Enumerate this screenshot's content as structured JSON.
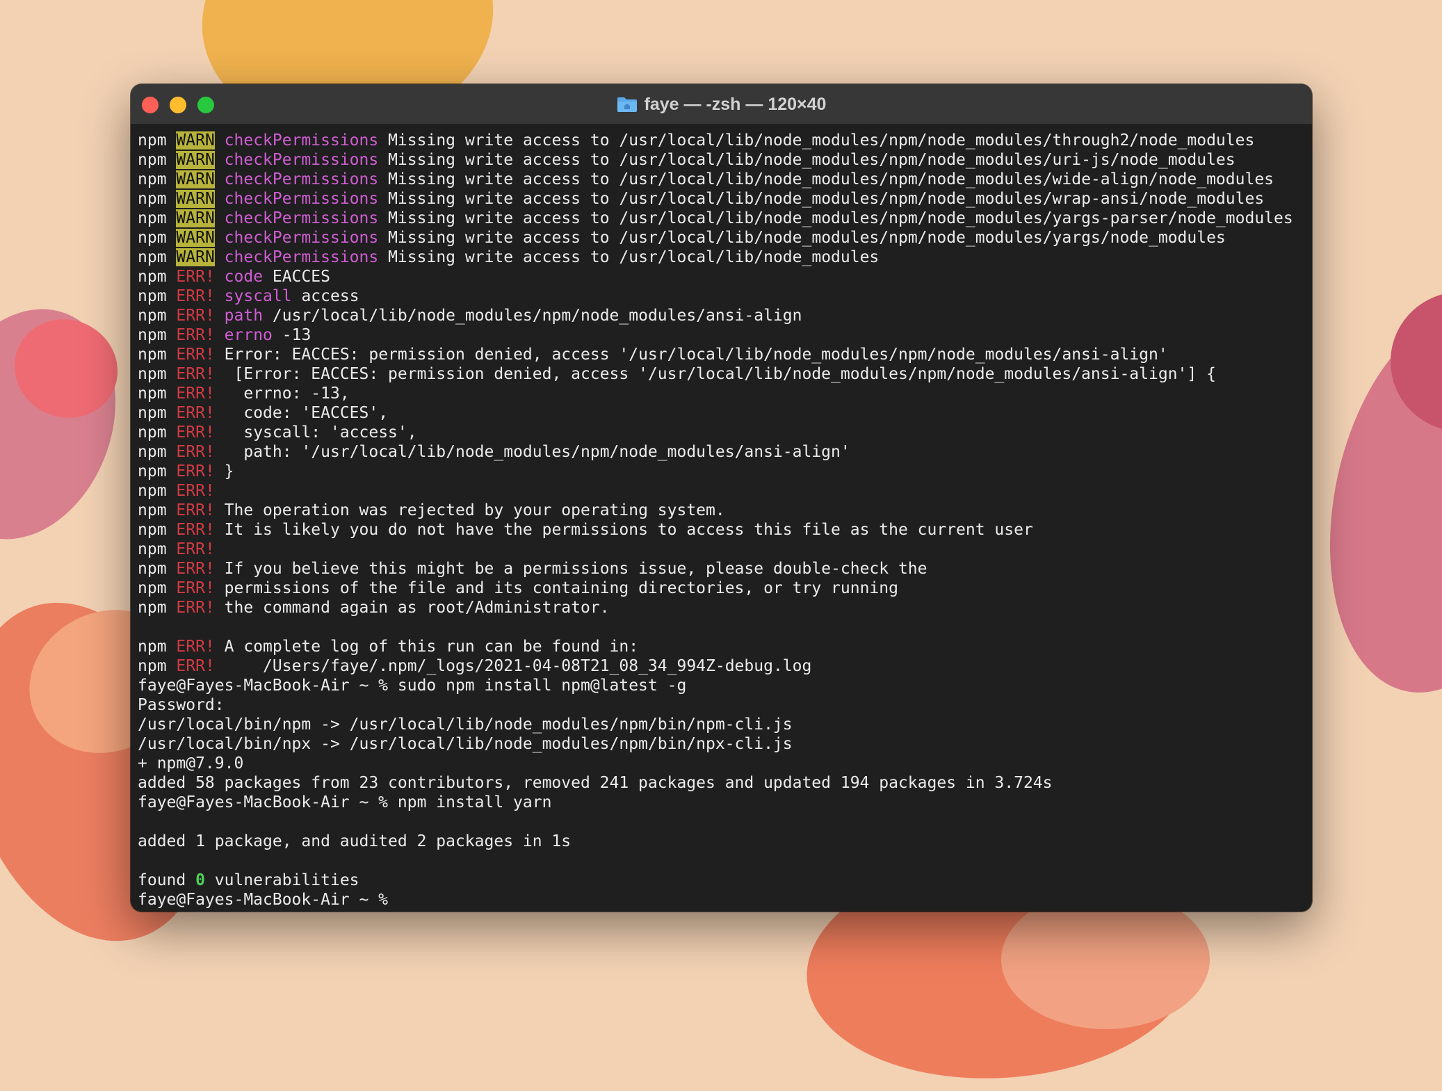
{
  "window": {
    "title": "faye — -zsh — 120×40"
  },
  "colors": {
    "warn_bg": "#b7b33b",
    "err_fg": "#d33a44",
    "key_fg": "#d05ed3",
    "ok_fg": "#4fd15a"
  },
  "terminal": {
    "warn_lines": [
      {
        "prefix": "npm",
        "level": "WARN",
        "key": "checkPermissions",
        "text": "Missing write access to /usr/local/lib/node_modules/npm/node_modules/through2/node_modules"
      },
      {
        "prefix": "npm",
        "level": "WARN",
        "key": "checkPermissions",
        "text": "Missing write access to /usr/local/lib/node_modules/npm/node_modules/uri-js/node_modules"
      },
      {
        "prefix": "npm",
        "level": "WARN",
        "key": "checkPermissions",
        "text": "Missing write access to /usr/local/lib/node_modules/npm/node_modules/wide-align/node_modules"
      },
      {
        "prefix": "npm",
        "level": "WARN",
        "key": "checkPermissions",
        "text": "Missing write access to /usr/local/lib/node_modules/npm/node_modules/wrap-ansi/node_modules"
      },
      {
        "prefix": "npm",
        "level": "WARN",
        "key": "checkPermissions",
        "text": "Missing write access to /usr/local/lib/node_modules/npm/node_modules/yargs-parser/node_modules"
      },
      {
        "prefix": "npm",
        "level": "WARN",
        "key": "checkPermissions",
        "text": "Missing write access to /usr/local/lib/node_modules/npm/node_modules/yargs/node_modules"
      },
      {
        "prefix": "npm",
        "level": "WARN",
        "key": "checkPermissions",
        "text": "Missing write access to /usr/local/lib/node_modules"
      }
    ],
    "err_lines": [
      {
        "prefix": "npm",
        "level": "ERR!",
        "key": "code",
        "text": "EACCES"
      },
      {
        "prefix": "npm",
        "level": "ERR!",
        "key": "syscall",
        "text": "access"
      },
      {
        "prefix": "npm",
        "level": "ERR!",
        "key": "path",
        "text": "/usr/local/lib/node_modules/npm/node_modules/ansi-align"
      },
      {
        "prefix": "npm",
        "level": "ERR!",
        "key": "errno",
        "text": "-13"
      },
      {
        "prefix": "npm",
        "level": "ERR!",
        "key": "",
        "text": "Error: EACCES: permission denied, access '/usr/local/lib/node_modules/npm/node_modules/ansi-align'"
      },
      {
        "prefix": "npm",
        "level": "ERR!",
        "key": "",
        "text": " [Error: EACCES: permission denied, access '/usr/local/lib/node_modules/npm/node_modules/ansi-align'] {"
      },
      {
        "prefix": "npm",
        "level": "ERR!",
        "key": "",
        "text": "  errno: -13,"
      },
      {
        "prefix": "npm",
        "level": "ERR!",
        "key": "",
        "text": "  code: 'EACCES',"
      },
      {
        "prefix": "npm",
        "level": "ERR!",
        "key": "",
        "text": "  syscall: 'access',"
      },
      {
        "prefix": "npm",
        "level": "ERR!",
        "key": "",
        "text": "  path: '/usr/local/lib/node_modules/npm/node_modules/ansi-align'"
      },
      {
        "prefix": "npm",
        "level": "ERR!",
        "key": "",
        "text": "}"
      },
      {
        "prefix": "npm",
        "level": "ERR!",
        "key": "",
        "text": ""
      },
      {
        "prefix": "npm",
        "level": "ERR!",
        "key": "",
        "text": "The operation was rejected by your operating system."
      },
      {
        "prefix": "npm",
        "level": "ERR!",
        "key": "",
        "text": "It is likely you do not have the permissions to access this file as the current user"
      },
      {
        "prefix": "npm",
        "level": "ERR!",
        "key": "",
        "text": ""
      },
      {
        "prefix": "npm",
        "level": "ERR!",
        "key": "",
        "text": "If you believe this might be a permissions issue, please double-check the"
      },
      {
        "prefix": "npm",
        "level": "ERR!",
        "key": "",
        "text": "permissions of the file and its containing directories, or try running"
      },
      {
        "prefix": "npm",
        "level": "ERR!",
        "key": "",
        "text": "the command again as root/Administrator."
      }
    ],
    "log_lines": [
      {
        "prefix": "npm",
        "level": "ERR!",
        "key": "",
        "text": "A complete log of this run can be found in:"
      },
      {
        "prefix": "npm",
        "level": "ERR!",
        "key": "",
        "text": "    /Users/faye/.npm/_logs/2021-04-08T21_08_34_994Z-debug.log"
      }
    ],
    "plain_lines": [
      "faye@Fayes-MacBook-Air ~ % sudo npm install npm@latest -g",
      "Password:",
      "/usr/local/bin/npm -> /usr/local/lib/node_modules/npm/bin/npm-cli.js",
      "/usr/local/bin/npx -> /usr/local/lib/node_modules/npm/bin/npx-cli.js",
      "+ npm@7.9.0",
      "added 58 packages from 23 contributors, removed 241 packages and updated 194 packages in 3.724s",
      "faye@Fayes-MacBook-Air ~ % npm install yarn",
      "",
      "added 1 package, and audited 2 packages in 1s",
      ""
    ],
    "found": {
      "before": "found ",
      "count": "0",
      "after": " vulnerabilities"
    },
    "prompt": "faye@Fayes-MacBook-Air ~ % "
  }
}
